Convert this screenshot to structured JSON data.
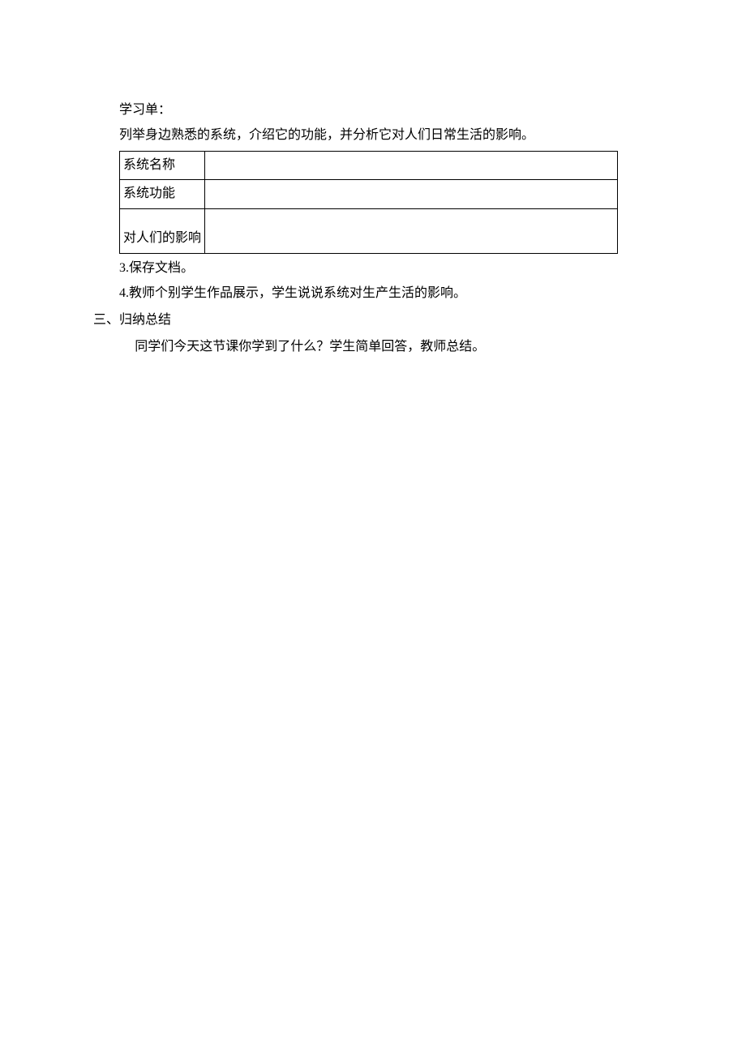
{
  "lines": {
    "study_sheet": "学习单：",
    "instruction": "列举身边熟悉的系统，介绍它的功能，并分析它对人们日常生活的影响。",
    "item3": "3.保存文档。",
    "item4": "4.教师个别学生作品展示，学生说说系统对生产生活的影响。",
    "section3": "三、归纳总结",
    "summary": "同学们今天这节课你学到了什么？学生简单回答，教师总结。"
  },
  "table": {
    "rows": [
      {
        "label": "系统名称",
        "value": ""
      },
      {
        "label": "系统功能",
        "value": ""
      },
      {
        "label": "对人们的影响",
        "value": ""
      }
    ]
  }
}
